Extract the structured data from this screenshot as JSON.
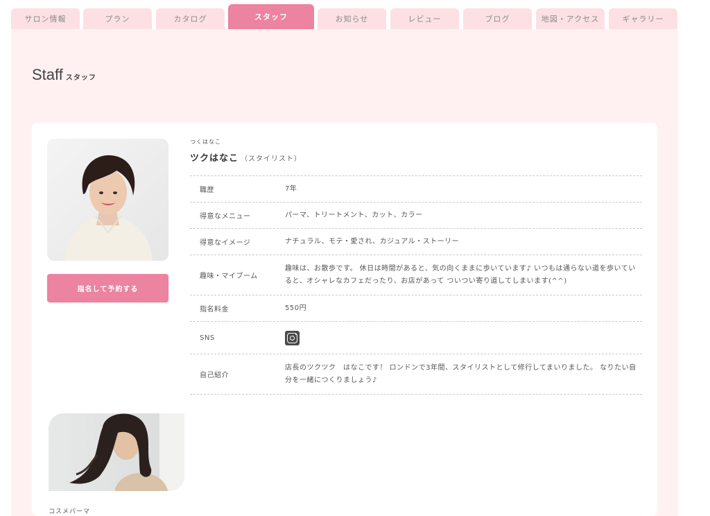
{
  "tabs": [
    {
      "label": "サロン情報"
    },
    {
      "label": "プラン"
    },
    {
      "label": "カタログ"
    },
    {
      "label": "スタッフ"
    },
    {
      "label": "お知らせ"
    },
    {
      "label": "レビュー"
    },
    {
      "label": "ブログ"
    },
    {
      "label": "地図・アクセス"
    },
    {
      "label": "ギャラリー"
    }
  ],
  "active_tab": "スタッフ",
  "page": {
    "title": "Staff",
    "subtitle": "スタッフ"
  },
  "staff": {
    "kana": "つくはなこ",
    "name": "ツクはなこ",
    "role": "（スタイリスト）",
    "reserve_label": "指名して予約する",
    "details": [
      {
        "label": "職歴",
        "value": "7年"
      },
      {
        "label": "得意なメニュー",
        "value": "パーマ、トリートメント、カット、カラー"
      },
      {
        "label": "得意なイメージ",
        "value": "ナチュラル、モテ・愛され、カジュアル・ストーリー"
      },
      {
        "label": "趣味・マイブーム",
        "value": "趣味は、お散歩です。 休日は時間があると、気の向くままに歩いています♪ いつもは通らない道を歩いていると、オシャレなカフェだったり、お店があって ついつい寄り道してしまいます(^^)"
      },
      {
        "label": "指名料金",
        "value": "550円"
      },
      {
        "label": "SNS",
        "value": ""
      },
      {
        "label": "自己紹介",
        "value": "店長のツクツク　はなこです！ ロンドンで3年間、スタイリストとして修行してまいりました。 なりたい自分を一緒につくりましょう♪"
      }
    ],
    "sns_icon": "instagram-icon"
  },
  "style_caption": "コスメパーマ",
  "colors": {
    "accent": "#ec83a0",
    "tab_bg": "#fde0e3",
    "page_bg": "#fff1f1"
  }
}
